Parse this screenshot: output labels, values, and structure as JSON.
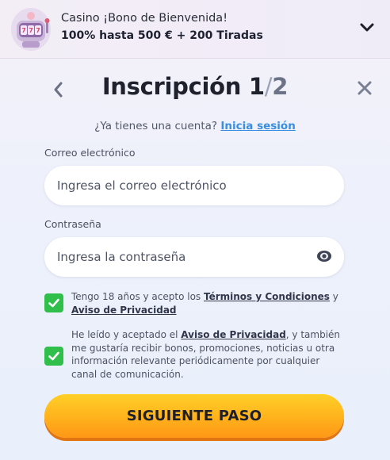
{
  "banner": {
    "line1": "Casino ¡Bono de Bienvenida!",
    "line2": "100% hasta 500 € + 200 Tiradas",
    "thumbnail_icon": "slot-machine-icon",
    "toggle_icon": "chevron-down-icon"
  },
  "header": {
    "title": "Inscripción",
    "step": "1",
    "separator": "/",
    "total": "2",
    "back_icon": "chevron-left-icon",
    "close_icon": "close-icon"
  },
  "login": {
    "prompt": "¿Ya tienes una cuenta?",
    "link": "Inicia sesión"
  },
  "form": {
    "email_label": "Correo electrónico",
    "email_placeholder": "Ingresa el correo electrónico",
    "email_value": "",
    "password_label": "Contraseña",
    "password_placeholder": "Ingresa la contraseña",
    "password_value": "",
    "password_toggle_icon": "eye-icon"
  },
  "consents": [
    {
      "checked": true,
      "text_before": "Tengo 18 años y acepto los ",
      "link1": "Términos y Condiciones",
      "text_middle": " y ",
      "link2": "Aviso de Privacidad"
    },
    {
      "checked": true,
      "text_before": "He leído y aceptado el ",
      "link1": "Aviso de Privacidad",
      "text_after": ", y también me gustaría recibir bonos, promociones, noticias u otra información relevante periódicamente por cualquier canal de comunicación."
    }
  ],
  "cta": {
    "label": "SIGUIENTE PASO"
  },
  "colors": {
    "accent_link": "#3a8ee0",
    "checkbox_green": "#2fbf4a",
    "cta_yellow": "#ffc21f",
    "cta_orange": "#ff9716"
  }
}
